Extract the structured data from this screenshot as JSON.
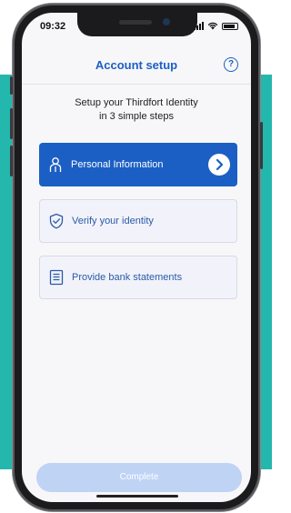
{
  "status_bar": {
    "time": "09:32"
  },
  "header": {
    "title": "Account setup",
    "help_icon": "help-icon",
    "help_symbol": "?"
  },
  "intro": {
    "line1": "Setup your Thirdfort Identity",
    "line2": "in 3 simple steps"
  },
  "steps": [
    {
      "label": "Personal Information",
      "icon": "person-icon",
      "active": true
    },
    {
      "label": "Verify your identity",
      "icon": "shield-check-icon",
      "active": false
    },
    {
      "label": "Provide bank statements",
      "icon": "document-icon",
      "active": false
    }
  ],
  "footer": {
    "button_label": "Complete"
  },
  "colors": {
    "accent": "#1c5fc4",
    "teal_background": "#23b7ad",
    "disabled_button": "#bfd3f5"
  }
}
